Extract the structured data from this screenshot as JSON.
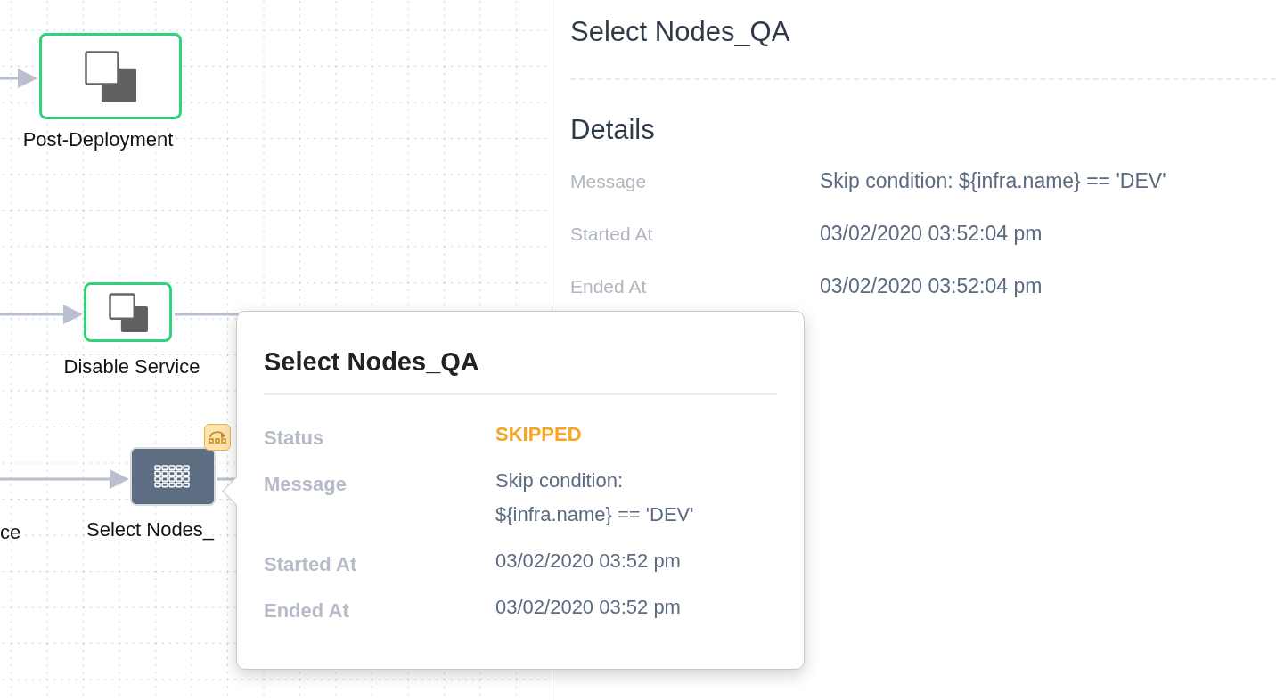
{
  "canvas": {
    "nodes": [
      {
        "label": "Post-Deployment",
        "kind": "success"
      },
      {
        "label": "Disable Service",
        "kind": "success"
      },
      {
        "label": "ce"
      },
      {
        "label": "Select Nodes_",
        "kind": "skipped",
        "skip_badge": true
      }
    ]
  },
  "details_panel": {
    "title": "Select Nodes_QA",
    "section": "Details",
    "rows": [
      {
        "label": "Message",
        "value": "Skip condition: ${infra.name} == 'DEV'"
      },
      {
        "label": "Started At",
        "value": "03/02/2020 03:52:04 pm"
      },
      {
        "label": "Ended At",
        "value": "03/02/2020 03:52:04 pm"
      }
    ]
  },
  "popover": {
    "title": "Select Nodes_QA",
    "rows": [
      {
        "label": "Status",
        "value": "SKIPPED",
        "kind": "status"
      },
      {
        "label": "Message",
        "value": "Skip condition: ${infra.name} == 'DEV'",
        "kind": "text"
      },
      {
        "label": "Started At",
        "value": "03/02/2020 03:52 pm",
        "kind": "text"
      },
      {
        "label": "Ended At",
        "value": "03/02/2020 03:52 pm",
        "kind": "text"
      }
    ]
  }
}
